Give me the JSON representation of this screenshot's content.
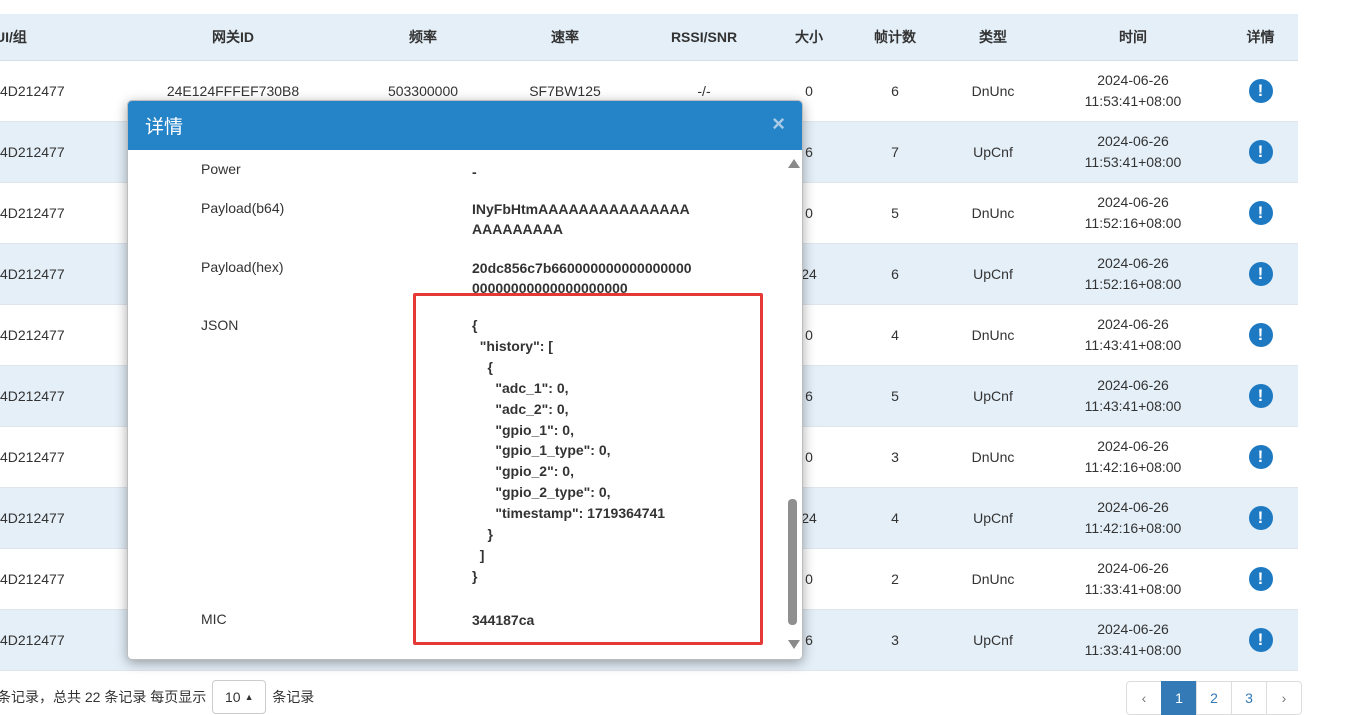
{
  "table": {
    "headers": [
      "UI/组",
      "网关ID",
      "频率",
      "速率",
      "RSSI/SNR",
      "大小",
      "帧计数",
      "类型",
      "时间",
      "详情"
    ],
    "rows": [
      {
        "eui": "4D212477",
        "gateway": "24E124FFFEF730B8",
        "freq": "503300000",
        "rate": "SF7BW125",
        "rssi": "-/-",
        "size": "0",
        "fcnt": "6",
        "type": "DnUnc",
        "date": "2024-06-26",
        "time": "11:53:41+08:00"
      },
      {
        "eui": "4D212477",
        "gateway": "",
        "freq": "",
        "rate": "",
        "rssi": "",
        "size": "6",
        "fcnt": "7",
        "type": "UpCnf",
        "date": "2024-06-26",
        "time": "11:53:41+08:00"
      },
      {
        "eui": "4D212477",
        "gateway": "",
        "freq": "",
        "rate": "",
        "rssi": "",
        "size": "0",
        "fcnt": "5",
        "type": "DnUnc",
        "date": "2024-06-26",
        "time": "11:52:16+08:00"
      },
      {
        "eui": "4D212477",
        "gateway": "",
        "freq": "",
        "rate": "",
        "rssi": "",
        "size": "24",
        "fcnt": "6",
        "type": "UpCnf",
        "date": "2024-06-26",
        "time": "11:52:16+08:00"
      },
      {
        "eui": "4D212477",
        "gateway": "",
        "freq": "",
        "rate": "",
        "rssi": "",
        "size": "0",
        "fcnt": "4",
        "type": "DnUnc",
        "date": "2024-06-26",
        "time": "11:43:41+08:00"
      },
      {
        "eui": "4D212477",
        "gateway": "",
        "freq": "",
        "rate": "",
        "rssi": "",
        "size": "6",
        "fcnt": "5",
        "type": "UpCnf",
        "date": "2024-06-26",
        "time": "11:43:41+08:00"
      },
      {
        "eui": "4D212477",
        "gateway": "",
        "freq": "",
        "rate": "",
        "rssi": "",
        "size": "0",
        "fcnt": "3",
        "type": "DnUnc",
        "date": "2024-06-26",
        "time": "11:42:16+08:00"
      },
      {
        "eui": "4D212477",
        "gateway": "",
        "freq": "",
        "rate": "",
        "rssi": "",
        "size": "24",
        "fcnt": "4",
        "type": "UpCnf",
        "date": "2024-06-26",
        "time": "11:42:16+08:00"
      },
      {
        "eui": "4D212477",
        "gateway": "",
        "freq": "",
        "rate": "",
        "rssi": "",
        "size": "0",
        "fcnt": "2",
        "type": "DnUnc",
        "date": "2024-06-26",
        "time": "11:33:41+08:00"
      },
      {
        "eui": "4D212477",
        "gateway": "",
        "freq": "",
        "rate": "",
        "rssi": "",
        "size": "6",
        "fcnt": "3",
        "type": "UpCnf",
        "date": "2024-06-26",
        "time": "11:33:41+08:00"
      }
    ],
    "detail_icon": "info-icon",
    "detail_glyph": "!"
  },
  "footer": {
    "prefix": "条记录，总共 22 条记录 每页显示",
    "page_size": "10",
    "suffix": "条记录"
  },
  "pagination": {
    "prev": "‹",
    "pages": [
      "1",
      "2",
      "3"
    ],
    "active": "1",
    "next": "›"
  },
  "modal": {
    "title": "详情",
    "close": "×",
    "fields": {
      "power_label": "Power",
      "power_value": "-",
      "payload_b64_label": "Payload(b64)",
      "payload_b64_value": "INyFbHtmAAAAAAAAAAAAAAAAAAAAAAAA",
      "payload_hex_label": "Payload(hex)",
      "payload_hex_value": "20dc856c7b66000000000000000000000000000000000000",
      "json_label": "JSON",
      "json_value": "{\n  \"history\": [\n    {\n      \"adc_1\": 0,\n      \"adc_2\": 0,\n      \"gpio_1\": 0,\n      \"gpio_1_type\": 0,\n      \"gpio_2\": 0,\n      \"gpio_2_type\": 0,\n      \"timestamp\": 1719364741\n    }\n  ]\n}",
      "mic_label": "MIC",
      "mic_value": "344187ca"
    },
    "highlight_color": "#e53935",
    "header_color": "#2583c8"
  }
}
